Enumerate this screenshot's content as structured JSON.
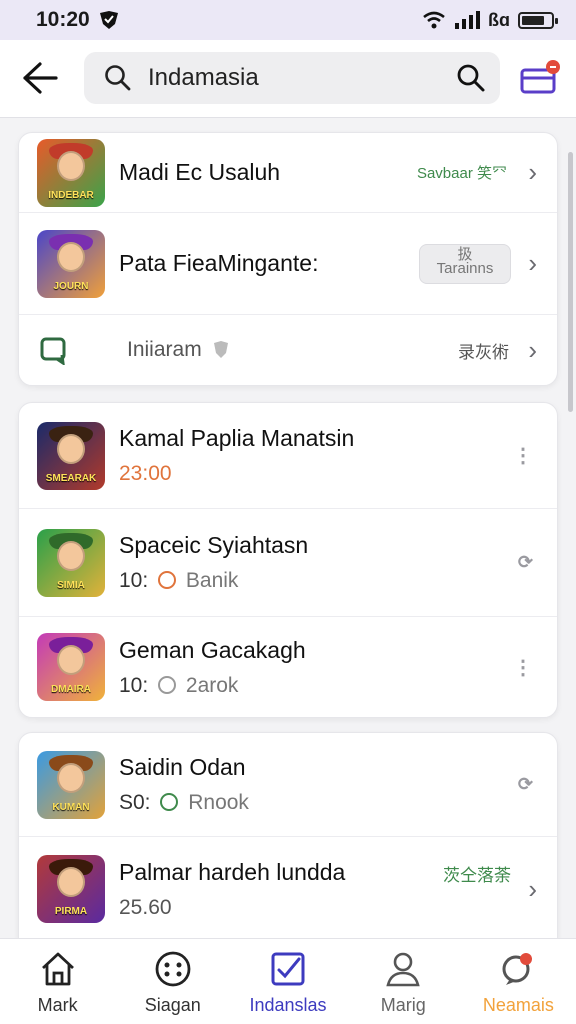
{
  "status": {
    "time": "10:20",
    "signal_text": "ßɑ"
  },
  "search": {
    "query": "Indamasia"
  },
  "top_card": [
    {
      "title": "Madi Ec Usaluh",
      "thumb_text": "INDEBAR",
      "badge": "Savbaar 笑㓁",
      "badge_color": "#3f8a4c"
    },
    {
      "title": "Pata FieaMingante:",
      "thumb_text": "JOURN",
      "pill": "Tarainns",
      "pill_top": "扱"
    },
    {
      "title": "Iniiaram",
      "trail": "录灰術"
    }
  ],
  "list": [
    {
      "title": "Kamal Paplia Manatsin",
      "thumb_text": "SMEARAK",
      "price": "23:00",
      "price_color": "#e0743c",
      "action": "⋮"
    },
    {
      "title": "Spaceic Syiahtasn",
      "thumb_text": "SIMIA",
      "price": "10:",
      "status": "Banik",
      "action": "⟳"
    },
    {
      "title": "Geman Gacakagh",
      "thumb_text": "DMAIRA",
      "price": "10:",
      "status": "2arok",
      "action": "⋮"
    }
  ],
  "list2": [
    {
      "title": "Saidin Odan",
      "thumb_text": "KUMAN",
      "price": "S0:",
      "status": "Rnook",
      "action": "⟳"
    },
    {
      "title": "Palmar hardeh lundda",
      "thumb_text": "PIRMA",
      "price": "25.60",
      "badge": "茨仝落荼",
      "badge_color": "#3f8a4c"
    }
  ],
  "nav": [
    {
      "label": "Mark",
      "icon": "home-icon",
      "color": "#222222"
    },
    {
      "label": "Siagan",
      "icon": "face-dots-icon",
      "color": "#222222"
    },
    {
      "label": "Indanslas",
      "icon": "checkbox-icon",
      "color": "#3d3bbf"
    },
    {
      "label": "Marig",
      "icon": "person-icon",
      "color": "#666666"
    },
    {
      "label": "Neamais",
      "icon": "chat-icon",
      "color": "#f2a23b"
    }
  ]
}
